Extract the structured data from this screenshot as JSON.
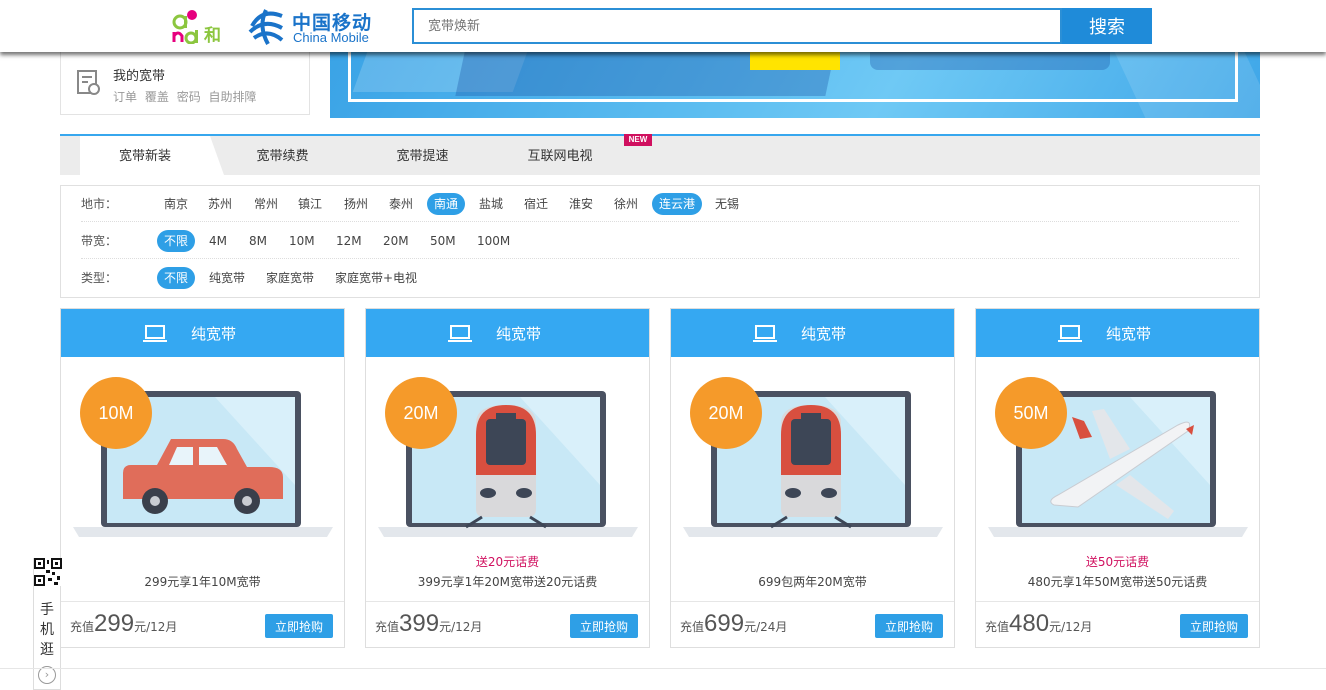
{
  "header": {
    "brand_and_text": "和",
    "brand_cn": "中国移动",
    "brand_en": "China Mobile",
    "search_placeholder": "宽带焕新",
    "search_button": "搜索"
  },
  "my_broadband": {
    "title": "我的宽带",
    "links": [
      "订单",
      "覆盖",
      "密码",
      "自助排障"
    ]
  },
  "tabs": [
    {
      "label": "宽带新装",
      "active": true
    },
    {
      "label": "宽带续费",
      "active": false
    },
    {
      "label": "宽带提速",
      "active": false
    },
    {
      "label": "互联网电视",
      "active": false,
      "badge": "NEW"
    }
  ],
  "filters": {
    "city": {
      "label": "地市：",
      "options": [
        "南京",
        "苏州",
        "常州",
        "镇江",
        "扬州",
        "泰州",
        "南通",
        "盐城",
        "宿迁",
        "淮安",
        "徐州",
        "连云港",
        "无锡"
      ],
      "selected": [
        "南通",
        "连云港"
      ]
    },
    "bandwidth": {
      "label": "带宽：",
      "options": [
        "不限",
        "4M",
        "8M",
        "10M",
        "12M",
        "20M",
        "50M",
        "100M"
      ],
      "selected": [
        "不限"
      ]
    },
    "type": {
      "label": "类型：",
      "options": [
        "不限",
        "纯宽带",
        "家庭宽带",
        "家庭宽带+电视"
      ],
      "selected": [
        "不限"
      ]
    }
  },
  "cards": [
    {
      "category": "纯宽带",
      "speed": "10M",
      "image": "car-icon",
      "promo": "",
      "desc": "299元享1年10M宽带",
      "price_prefix": "充值",
      "price": "299",
      "price_suffix": "元/12月",
      "buy": "立即抢购"
    },
    {
      "category": "纯宽带",
      "speed": "20M",
      "image": "train-icon",
      "promo": "送20元话费",
      "desc": "399元享1年20M宽带送20元话费",
      "price_prefix": "充值",
      "price": "399",
      "price_suffix": "元/12月",
      "buy": "立即抢购"
    },
    {
      "category": "纯宽带",
      "speed": "20M",
      "image": "train-icon",
      "promo": "",
      "desc": "699包两年20M宽带",
      "price_prefix": "充值",
      "price": "699",
      "price_suffix": "元/24月",
      "buy": "立即抢购"
    },
    {
      "category": "纯宽带",
      "speed": "50M",
      "image": "airplane-icon",
      "promo": "送50元话费",
      "desc": "480元享1年50M宽带送50元话费",
      "price_prefix": "充值",
      "price": "480",
      "price_suffix": "元/12月",
      "buy": "立即抢购"
    }
  ],
  "side_panel": {
    "text": "手机逛",
    "arrow": "›"
  },
  "colors": {
    "accent": "#35a8f2",
    "badge_orange": "#f59a2a",
    "promo_pink": "#d0105f",
    "brand_blue": "#1a73c9"
  }
}
